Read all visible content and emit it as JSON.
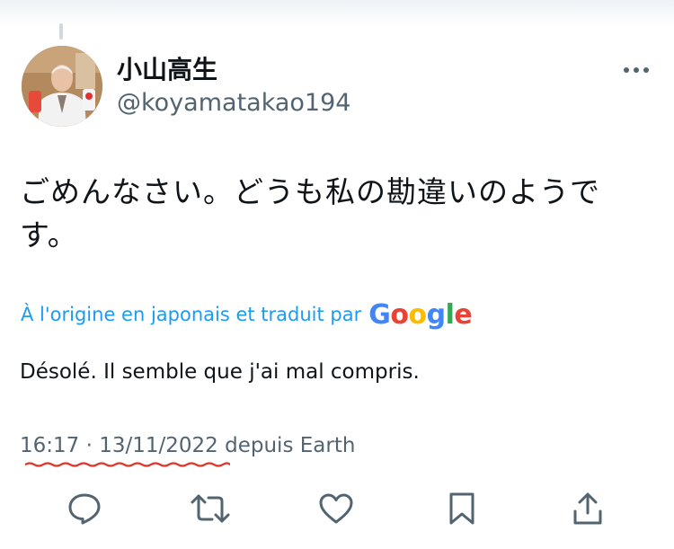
{
  "user": {
    "display_name": "小山高生",
    "handle": "@koyamatakao194"
  },
  "tweet": {
    "text_line1": "ごめんなさい。どうも私の勘違いのようで",
    "text_line2": "す。",
    "translation_note": "À l'origine en japonais et traduit par",
    "translation_provider": "Google",
    "translated_text": "Désolé. Il semble que j'ai mal compris.",
    "time": "16:17",
    "separator": "·",
    "date": "13/11/2022",
    "source": "depuis Earth"
  },
  "icons": {
    "more": "more-horizontal-icon",
    "reply": "reply-icon",
    "retweet": "retweet-icon",
    "like": "heart-icon",
    "bookmark": "bookmark-icon",
    "share": "share-icon"
  },
  "colors": {
    "accent": "#1d9bf0",
    "secondary_text": "#536471",
    "primary_text": "#0f1419",
    "annotation_red": "#e0352b",
    "google_blue": "#4285f4",
    "google_red": "#ea4335",
    "google_yellow": "#fbbc05",
    "google_green": "#34a853"
  }
}
